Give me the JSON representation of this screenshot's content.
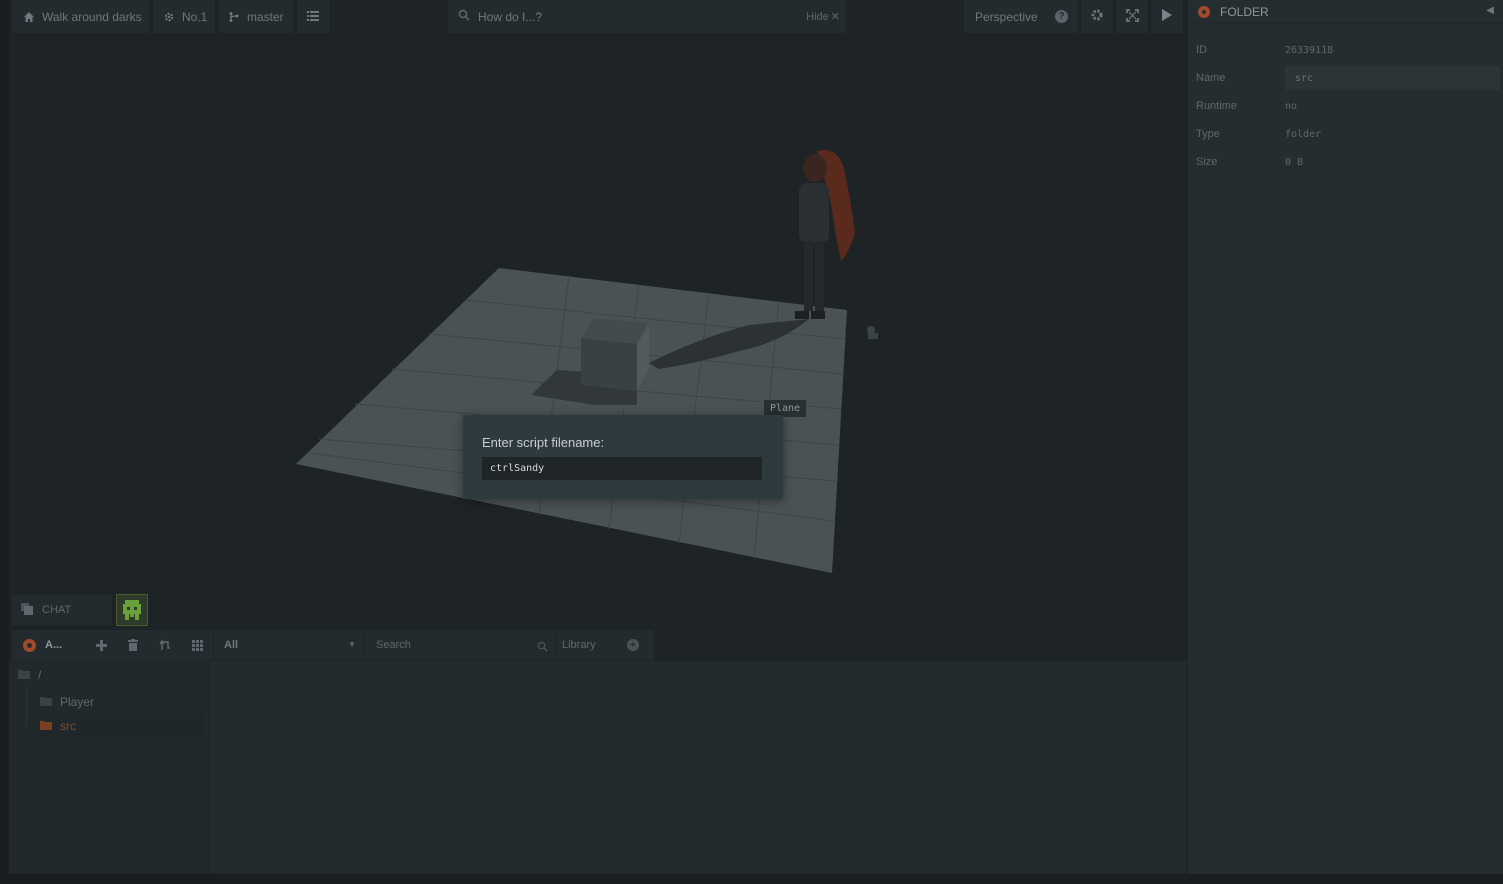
{
  "toolbar": {
    "project": "Walk around darks",
    "scene": "No.1",
    "branch": "master",
    "search_placeholder": "How do I...?",
    "hide_label": "Hide",
    "view_mode": "Perspective",
    "help_glyph": "?"
  },
  "viewport": {
    "selected_label": "Plane"
  },
  "dialog": {
    "label": "Enter script filename:",
    "value": "ctrlSandy"
  },
  "inspector": {
    "title": "FOLDER",
    "rows": [
      {
        "key": "ID",
        "value": "26339118"
      },
      {
        "key": "Name",
        "value": "src"
      },
      {
        "key": "Runtime",
        "value": "no"
      },
      {
        "key": "Type",
        "value": "folder"
      },
      {
        "key": "Size",
        "value": "0 B"
      }
    ]
  },
  "chat": {
    "label": "CHAT"
  },
  "assets": {
    "title": "A...",
    "filter": "All",
    "search_placeholder": "Search",
    "library": "Library",
    "tree": {
      "root": "/",
      "items": [
        "Player",
        "src"
      ]
    }
  },
  "colors": {
    "accent": "#a14a2a",
    "background": "#1e2326",
    "panel": "#242b2e"
  }
}
